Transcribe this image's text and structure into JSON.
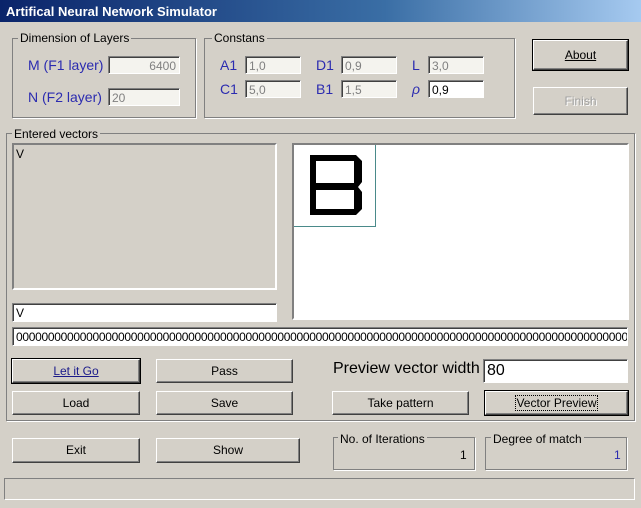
{
  "window": {
    "title": "Artifical Neural Network Simulator"
  },
  "dimensions": {
    "legend": "Dimension of Layers",
    "m_label": "M (F1 layer)",
    "m_value": "6400",
    "n_label": "N (F2 layer)",
    "n_value": "20"
  },
  "constants": {
    "legend": "Constans",
    "a1_label": "A1",
    "a1_value": "1,0",
    "d1_label": "D1",
    "d1_value": "0,9",
    "l_label": "L",
    "l_value": "3,0",
    "c1_label": "C1",
    "c1_value": "5,0",
    "b1_label": "B1",
    "b1_value": "1,5",
    "rho_label": "ρ",
    "rho_value": "0,9"
  },
  "buttons": {
    "about": "About",
    "finish": "Finish",
    "let_it_go": "Let it Go",
    "pass": "Pass",
    "load": "Load",
    "save": "Save",
    "take_pattern": "Take pattern",
    "vector_preview": "Vector Preview",
    "exit": "Exit",
    "show": "Show"
  },
  "vectors": {
    "legend": "Entered vectors",
    "list_items": [
      "V"
    ],
    "name_input": "V",
    "vector_string": "00000000000000000000000000000000000000000000000000000000000000000000000000000000000000000000000000",
    "preview_letter": "B"
  },
  "preview": {
    "width_label": "Preview vector width",
    "width_value": "80"
  },
  "stats": {
    "iterations_label": "No. of Iterations",
    "iterations_value": "1",
    "match_label": "Degree of match",
    "match_value": "1"
  }
}
